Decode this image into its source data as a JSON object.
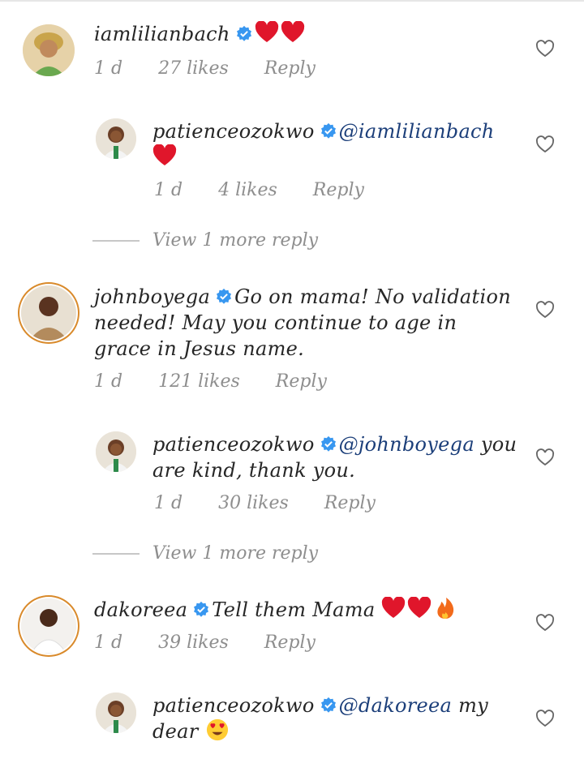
{
  "comments": [
    {
      "username": "iamlilianbach",
      "text": "",
      "time": "1 d",
      "likes": "27 likes",
      "reply": "Reply"
    },
    {
      "username": "patienceozokwo",
      "mention": "@iamlilianbach",
      "text": "",
      "time": "1 d",
      "likes": "4 likes",
      "reply": "Reply"
    },
    {
      "username": "johnboyega",
      "text": "Go on mama! No validation needed! May you continue to age in grace in Jesus name.",
      "time": "1 d",
      "likes": "121 likes",
      "reply": "Reply"
    },
    {
      "username": "patienceozokwo",
      "mention": "@johnboyega",
      "text": " you are kind, thank you.",
      "time": "1 d",
      "likes": "30 likes",
      "reply": "Reply"
    },
    {
      "username": "dakoreea",
      "text": "Tell them Mama",
      "time": "1 d",
      "likes": "39 likes",
      "reply": "Reply"
    },
    {
      "username": "patienceozokwo",
      "mention": "@dakoreea",
      "text": " my dear",
      "time": "1 d",
      "likes": "",
      "reply": ""
    }
  ],
  "view_more": [
    "View 1 more reply",
    "View 1 more reply"
  ],
  "icons": {
    "verified": "verified-badge-icon",
    "like": "heart-outline-icon",
    "emoji_heart": "red-heart-emoji",
    "emoji_fire": "fire-emoji",
    "emoji_hearteyes": "heart-eyes-emoji"
  },
  "colors": {
    "verified": "#3897f0",
    "mention": "#1c3f7a",
    "meta": "#8e8e8e",
    "heart": "#e0162b",
    "ring": "#d98a2b"
  }
}
